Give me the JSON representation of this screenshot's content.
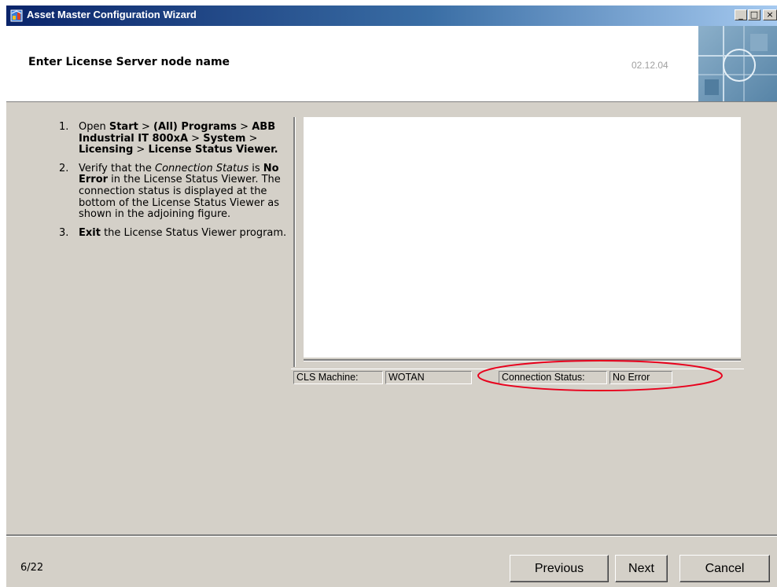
{
  "window": {
    "title": "Asset Master  Configuration Wizard",
    "controls": {
      "minimize": "_",
      "maximize": "□",
      "close": "×"
    }
  },
  "header": {
    "title": "Enter License Server node name",
    "version_date": "02.12.04"
  },
  "instructions": {
    "steps": [
      {
        "number": "1.",
        "parts": [
          {
            "text": "Open ",
            "style": "normal"
          },
          {
            "text": "Start",
            "style": "bold"
          },
          {
            "text": " > ",
            "style": "normal"
          },
          {
            "text": "(All) Programs",
            "style": "bold"
          },
          {
            "text": " > ",
            "style": "normal"
          },
          {
            "text": "ABB Industrial IT 800xA",
            "style": "bold"
          },
          {
            "text": " > ",
            "style": "normal"
          },
          {
            "text": "System",
            "style": "bold"
          },
          {
            "text": " > ",
            "style": "normal"
          },
          {
            "text": "Licensing",
            "style": "bold"
          },
          {
            "text": " > ",
            "style": "normal"
          },
          {
            "text": "License Status Viewer.",
            "style": "bold"
          }
        ]
      },
      {
        "number": "2.",
        "parts": [
          {
            "text": "Verify that the ",
            "style": "normal"
          },
          {
            "text": "Connection Status",
            "style": "italic"
          },
          {
            "text": " is ",
            "style": "normal"
          },
          {
            "text": "No Error",
            "style": "bold"
          },
          {
            "text": " in the License Status Viewer. The connection status is displayed at the bottom of the License Status Viewer as shown in the adjoining figure.",
            "style": "normal"
          }
        ]
      },
      {
        "number": "3.",
        "parts": [
          {
            "text": "Exit",
            "style": "bold"
          },
          {
            "text": " the License Status Viewer program.",
            "style": "normal"
          }
        ]
      }
    ]
  },
  "figure": {
    "status_bar": {
      "machine_label": "CLS Machine:",
      "machine_value": "WOTAN",
      "status_label": "Connection Status:",
      "status_value": "No Error"
    },
    "highlight_color": "#e8001c"
  },
  "footer": {
    "page_indicator": "6/22",
    "previous_label": "Previous",
    "next_label": "Next",
    "cancel_label": "Cancel"
  }
}
